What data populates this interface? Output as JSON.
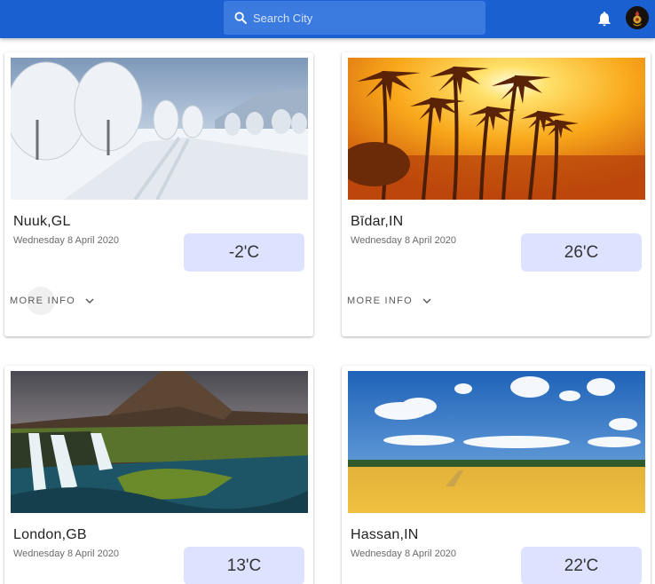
{
  "search": {
    "placeholder": "Search City",
    "icon": "search-icon"
  },
  "header": {
    "notification_icon": "bell-icon",
    "avatar_icon": "avatar"
  },
  "colors": {
    "appbar": "#1a60d0",
    "search_bg": "#3b7be0",
    "temp_badge": "#dde3ff"
  },
  "cards": [
    {
      "city": "Nuuk,GL",
      "date": "Wednesday 8 April 2020",
      "temp": "-2'C",
      "more": "MORE INFO",
      "scene": "snow"
    },
    {
      "city": "Bīdar,IN",
      "date": "Wednesday 8 April 2020",
      "temp": "26'C",
      "more": "MORE INFO",
      "scene": "palms-sunset"
    },
    {
      "city": "London,GB",
      "date": "Wednesday 8 April 2020",
      "temp": "13'C",
      "scene": "mountain-waterfall"
    },
    {
      "city": "Hassan,IN",
      "date": "Wednesday 8 April 2020",
      "temp": "22'C",
      "scene": "wheat-field"
    }
  ]
}
